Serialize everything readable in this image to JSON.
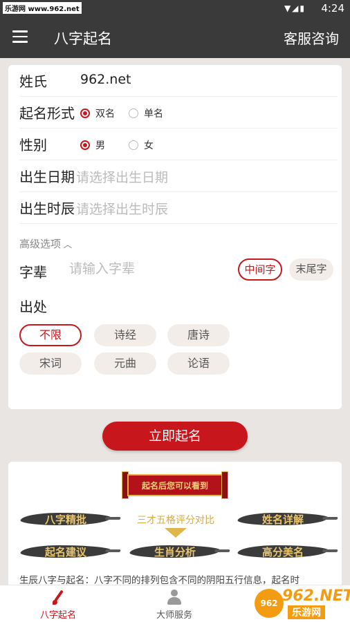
{
  "status_bar": {
    "watermark": "乐游网 www.962.net",
    "time": "4:24"
  },
  "header": {
    "title": "八字起名",
    "service_label": "客服咨询"
  },
  "form": {
    "surname": {
      "label": "姓氏",
      "value": "962.net"
    },
    "name_form": {
      "label": "起名形式",
      "options": [
        "双名",
        "单名"
      ],
      "selected": "双名"
    },
    "gender": {
      "label": "性别",
      "options": [
        "男",
        "女"
      ],
      "selected": "男"
    },
    "birth_date": {
      "label": "出生日期",
      "placeholder": "请选择出生日期"
    },
    "birth_time": {
      "label": "出生时辰",
      "placeholder": "请选择出生时辰"
    },
    "advanced": {
      "toggle_label": "高级选项",
      "generation": {
        "label": "字辈",
        "placeholder": "请输入字辈",
        "positions": [
          "中间字",
          "末尾字"
        ],
        "selected": "中间字"
      },
      "source": {
        "label": "出处",
        "options": [
          "不限",
          "诗经",
          "唐诗",
          "宋词",
          "元曲",
          "论语"
        ],
        "selected": "不限"
      }
    }
  },
  "submit_label": "立即起名",
  "promo": {
    "banner": "起名后您可以看到",
    "features": [
      "八字精批",
      "三才五格评分对比",
      "姓名详解",
      "起名建议",
      "生肖分析",
      "高分美名"
    ],
    "description": "生辰八字与起名：八字不同的排列包含不同的阴阳五行信息，起名时"
  },
  "tabs": [
    {
      "label": "八字起名",
      "icon": "brush-icon",
      "active": true
    },
    {
      "label": "大师服务",
      "icon": "person-icon",
      "active": false
    }
  ],
  "watermark_logo": {
    "big": "962.NET",
    "small": "乐游网"
  },
  "colors": {
    "accent": "#c8161d",
    "appbar": "#3a3a3a",
    "gold": "#d8a93c"
  }
}
